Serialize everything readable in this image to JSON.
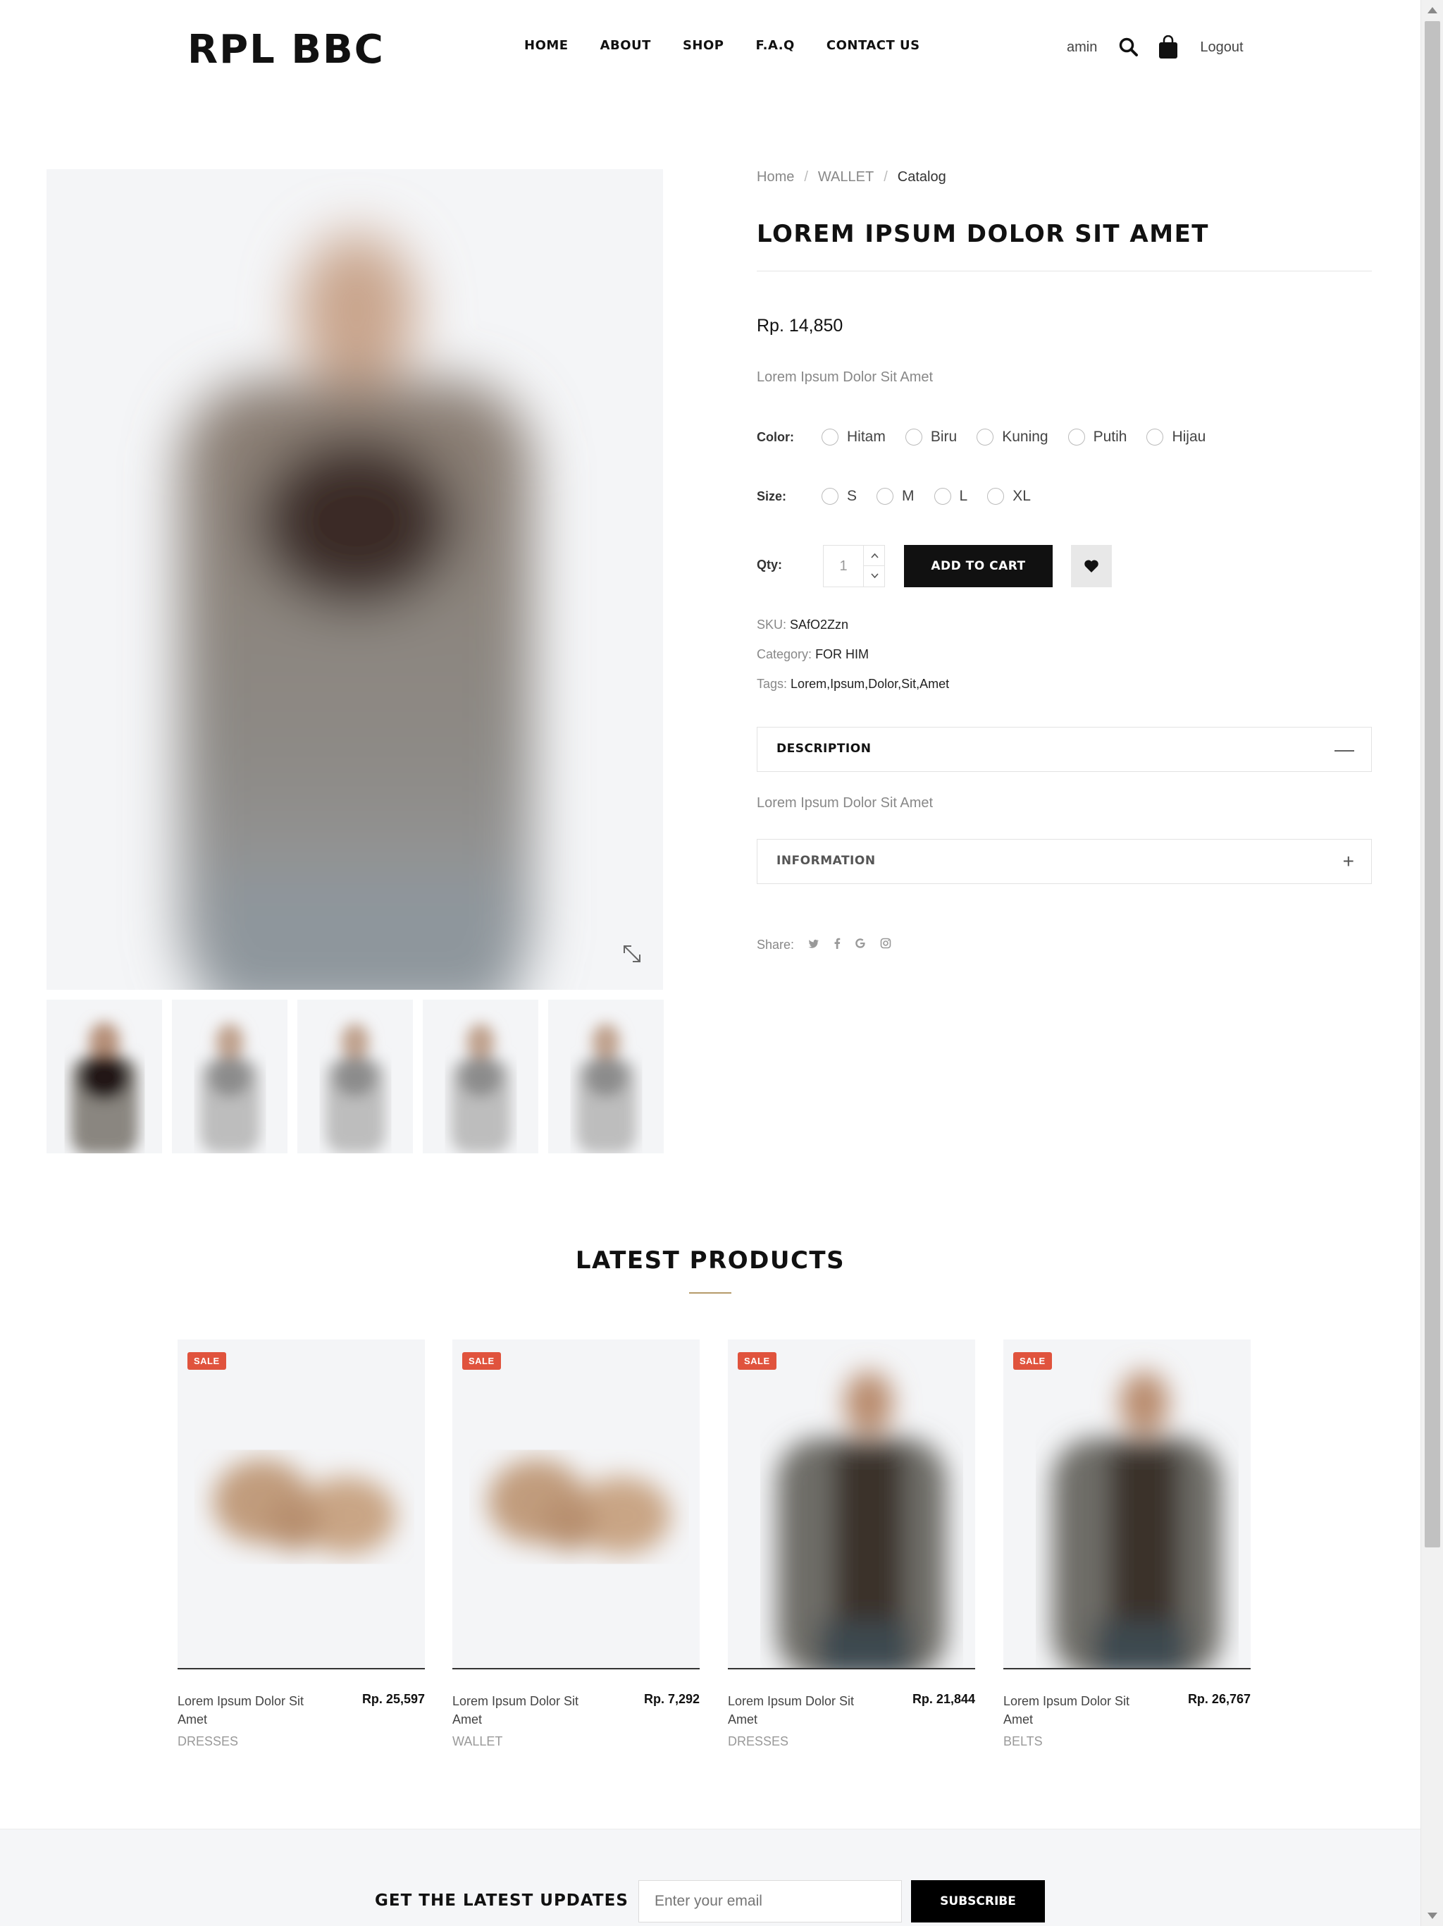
{
  "header": {
    "logo": "RPL BBC",
    "nav": [
      "HOME",
      "ABOUT",
      "SHOP",
      "F.A.Q",
      "CONTACT US"
    ],
    "user_name": "amin",
    "logout_label": "Logout"
  },
  "breadcrumb": [
    "Home",
    "WALLET",
    "Catalog"
  ],
  "product": {
    "title": "LOREM IPSUM DOLOR SIT AMET",
    "price": "Rp. 14,850",
    "short_description": "Lorem Ipsum Dolor Sit Amet",
    "color_label": "Color:",
    "colors": [
      "Hitam",
      "Biru",
      "Kuning",
      "Putih",
      "Hijau"
    ],
    "size_label": "Size:",
    "sizes": [
      "S",
      "M",
      "L",
      "XL"
    ],
    "qty_label": "Qty:",
    "qty_value": "1",
    "add_to_cart_label": "ADD TO CART",
    "sku_label": "SKU:",
    "sku": "SAfO2Zzn",
    "category_label": "Category:",
    "category": "FOR HIM",
    "tags_label": "Tags:",
    "tags": "Lorem,Ipsum,Dolor,Sit,Amet",
    "description_title": "DESCRIPTION",
    "description_sign": "—",
    "description_content": "Lorem Ipsum Dolor Sit Amet",
    "information_title": "INFORMATION",
    "information_sign": "+",
    "share_label": "Share:"
  },
  "icons": {
    "share": [
      "twitter-icon",
      "facebook-icon",
      "google-icon",
      "instagram-icon"
    ]
  },
  "latest": {
    "title": "LATEST PRODUCTS",
    "products": [
      {
        "badge": "SALE",
        "name": "Lorem Ipsum Dolor Sit Amet",
        "price": "Rp. 25,597",
        "category": "DRESSES",
        "image": "shoes"
      },
      {
        "badge": "SALE",
        "name": "Lorem Ipsum Dolor Sit Amet",
        "price": "Rp. 7,292",
        "category": "WALLET",
        "image": "shoes"
      },
      {
        "badge": "SALE",
        "name": "Lorem Ipsum Dolor Sit Amet",
        "price": "Rp. 21,844",
        "category": "DRESSES",
        "image": "person"
      },
      {
        "badge": "SALE",
        "name": "Lorem Ipsum Dolor Sit Amet",
        "price": "Rp. 26,767",
        "category": "BELTS",
        "image": "person"
      }
    ]
  },
  "newsletter": {
    "title": "GET THE LATEST UPDATES",
    "placeholder": "Enter your email",
    "button_label": "SUBSCRIBE"
  },
  "colors": {
    "sale_badge": "#e0533d",
    "accent_underline": "#b59b6a",
    "button_dark": "#111111"
  }
}
